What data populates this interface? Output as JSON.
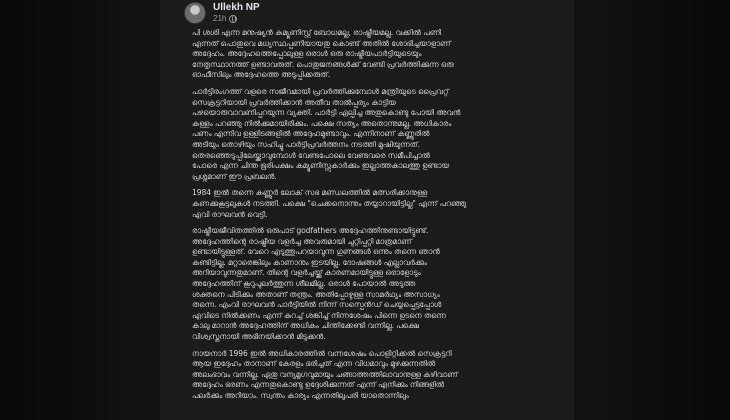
{
  "post": {
    "author": "Ullekh NP",
    "timestamp": "21h",
    "visibility_icon": "globe-icon",
    "paragraphs": [
      [
        "പി ശശി എന്ന മനുഷ്യൻ കമ്യൂണിസ്റ്റ് ബോധമല്ല, രാഷ്ട്രീയമല്ല. വക്കിൽ പണി",
        "എന്നത് പൊതുവെ മധ്യസ്ഥപ്പണിയായതു കൊണ്ട് അതിൽ ശോഭിച്ചയാളാണ്",
        "അദ്ദേഹം. അദ്ദേഹത്തെപ്പോലുള്ള ഒരാൾ ഒരു രാഷ്ട്രീയപാർട്ടിയുടെയും",
        "നേതൃസ്ഥാനത്ത് ഉണ്ടാവരുത്. പൊതുജനങ്ങൾക്ക് വേണ്ടി പ്രവർത്തിക്കുന്ന ഒരു",
        "ഓഫീസിലും അദ്ദേഹത്തെ അടുപ്പിക്കരുത്."
      ],
      [
        "പാർട്ടിരംഗത്ത് വളരെ സജീവമായി പ്രവർത്തിക്കുമ്പോൾ മന്ത്രിയുടെ പ്രൈവറ്റ്",
        "സെക്രട്ടറിയായി പ്രവർത്തിക്കാൻ അതീവ താൽപ്പര്യം കാട്ടിയ",
        "പഴയൊരുവാവണിപ്പറയുന്ന വ്യക്തി. പാർട്ടി ഏല്പിച്ച അതുകൊണ്ടു പോയി അവൻ",
        "കള്ളം പറഞ്ഞു നിൽക്കുമായിരിക്കും. പക്ഷെ സത്യം അതൊന്നുമല്ല. അധികാരം",
        "പണം എന്നിവ ഉള്ളിടങ്ങളിൽ അദ്ദേഹമുണ്ടാവും. എന്നിനാണ് കണ്ണൂരിൽ",
        "അടിയും തൊഴിയും സഹിച്ചു പാർട്ടിപ്രവർത്തനം നടത്തി മുഷിയുന്നത്.",
        "തെരഞ്ഞെടുപ്പിലേയ്ക്കാവുമ്പോൾ വേണ്ടപോലെ വേണ്ടവരെ സമീപിച്ചാൽ",
        "പോരെ എന്ന ചിന്ത ഭൂരിപക്ഷം കമ്യൂണിസ്റ്റുകാർക്കും ഇല്ലാത്തകാലത്തു ഉണ്ടായ",
        "പ്രശ്നമാണ് ഈ പ്രബലൻ."
      ],
      [
        "1984 ഇൽ തന്നെ കണ്ണൂർ ലോക് സഭ മണ്ഡലത്തിൽ മത്സരിക്കാനുള്ള",
        "കണക്കുകൂട്ടലുകൾ നടത്തി. പക്ഷെ \"ചെക്കനൊന്നും തയ്യാറായിട്ടില്ല\" എന്ന് പറഞ്ഞു",
        "എവി രാഘവൻ വെട്ടി."
      ],
      [
        "രാഷ്ട്രീയജീവിതത്തിൽ ഒരുപാട് godfathers അദ്ദേഹത്തിനുണ്ടായിട്ടുണ്ട്.",
        "അദ്ദേഹത്തിന്റെ രാഷ്ട്രീയ വളർച്ച അവരുമായി ചുറ്റിപ്പറ്റി മാത്രമാണ്",
        "ഉണ്ടായിട്ടുള്ളത്. വേറെ എടുത്തുപറയാവുന്ന ഗുണങ്ങൾ ഒന്നും തന്നെ ഞാൻ",
        "കണ്ടിട്ടില്ല. മറ്റാരെങ്കിലും കാണാനും ഇടയില്ല. ദോഷങ്ങൾ എല്ലാവർക്കും",
        "അറിയാവുന്നതുമാണ്. തിന്റെ വളർച്ചയ്ക്ക് കാരണമായിട്ടുള്ള ഒരാളോടും",
        "അദ്ദേഹത്തിന് കൂറുപുലർത്തുന്ന ശീലമില്ല. ഒരാൾ പോയാൽ അടുത്ത",
        "ശക്തനെ പിടിക്കും അതാണ് തന്ത്രം. അതിപ്പോഴുള്ള സാമർഥ്യം അസാധ്യം",
        "തന്നെ. എംവി രാഘവൻ പാർട്ടിയിൽ നിന്ന് സസ്പെൻഡ് ചെയ്യപ്പെട്ടപ്പോൾ",
        "എവിടെ നിൽക്കണം എന്ന് കുറച്ച് ശങ്കിച്ച് നിന്നശേഷം പിന്നെ ഉടനെ തന്നെ",
        "കാലു മാറാൻ അദ്ദേഹത്തിന് അധികം ചിന്തിക്കേണ്ടി വന്നില്ല. പക്ഷെ",
        "വിശ്വസ്തനായി അഭിനയിക്കാൻ മിടുക്കൻ."
      ],
      [
        "നായനാർ 1996 ഇൽ അധികാരത്തിൽ വന്നശേഷം പൊളിറ്റിക്കൽ സെക്രട്ടറി",
        "ആയ ഇദ്ദേഹം താനാണ് കേരളം ഭരിച്ചത് എന്ന വിധമാവും മുഴക്കുന്നതിൽ",
        "അലംഭാവം വന്നില്ല. ഏതു വന്യമൃഗവുമായും ചങ്ങാത്തത്തിലാവാനുള്ള കഴിവാണ്",
        "അദ്ദേഹം ഭരണം എന്നതുകൊണ്ടു ഉദ്ദേശിക്കുന്നത് എന്ന് എനിക്കും നിങ്ങളിൽ",
        "പലർക്കും അറിയാം. സ്വന്തം കാര്യം എന്നതിലുപരി യാതൊന്നിലും"
      ]
    ]
  }
}
